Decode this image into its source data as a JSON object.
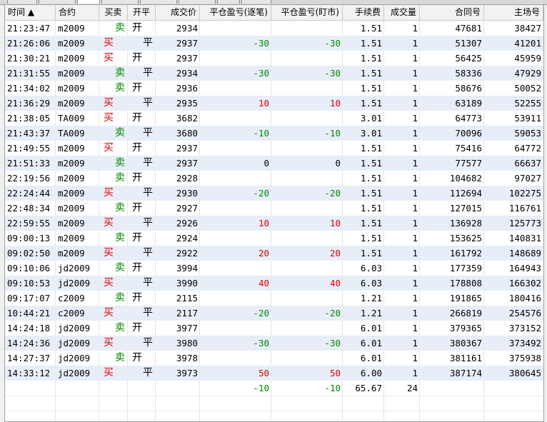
{
  "columns": {
    "time": "时间 ▲",
    "contract": "合约",
    "side": "买卖",
    "open_close": "开平",
    "price": "成交价",
    "pnl_trade": "平仓盈亏(逐笔)",
    "pnl_mark": "平仓盈亏(盯市)",
    "fee": "手续费",
    "volume": "成交量",
    "contract_no": "合同号",
    "main_no": "主场号"
  },
  "rows": [
    {
      "time": "21:23:47",
      "contract": "m2009",
      "side": "卖",
      "oc": "开",
      "price": "2934",
      "pnl_trade": "",
      "pnl_mark": "",
      "fee": "1.51",
      "vol": "1",
      "cno": "47681",
      "mno": "38427"
    },
    {
      "time": "21:26:06",
      "contract": "m2009",
      "side": "买",
      "oc": "平",
      "price": "2937",
      "pnl_trade": "-30",
      "pnl_mark": "-30",
      "fee": "1.51",
      "vol": "1",
      "cno": "51307",
      "mno": "41201"
    },
    {
      "time": "21:30:21",
      "contract": "m2009",
      "side": "买",
      "oc": "开",
      "price": "2937",
      "pnl_trade": "",
      "pnl_mark": "",
      "fee": "1.51",
      "vol": "1",
      "cno": "56425",
      "mno": "45959"
    },
    {
      "time": "21:31:55",
      "contract": "m2009",
      "side": "卖",
      "oc": "平",
      "price": "2934",
      "pnl_trade": "-30",
      "pnl_mark": "-30",
      "fee": "1.51",
      "vol": "1",
      "cno": "58336",
      "mno": "47929"
    },
    {
      "time": "21:34:02",
      "contract": "m2009",
      "side": "卖",
      "oc": "开",
      "price": "2936",
      "pnl_trade": "",
      "pnl_mark": "",
      "fee": "1.51",
      "vol": "1",
      "cno": "58676",
      "mno": "50052"
    },
    {
      "time": "21:36:29",
      "contract": "m2009",
      "side": "买",
      "oc": "平",
      "price": "2935",
      "pnl_trade": "10",
      "pnl_mark": "10",
      "fee": "1.51",
      "vol": "1",
      "cno": "63189",
      "mno": "52255"
    },
    {
      "time": "21:38:05",
      "contract": "TA009",
      "side": "买",
      "oc": "开",
      "price": "3682",
      "pnl_trade": "",
      "pnl_mark": "",
      "fee": "3.01",
      "vol": "1",
      "cno": "64773",
      "mno": "53911"
    },
    {
      "time": "21:43:37",
      "contract": "TA009",
      "side": "卖",
      "oc": "平",
      "price": "3680",
      "pnl_trade": "-10",
      "pnl_mark": "-10",
      "fee": "3.01",
      "vol": "1",
      "cno": "70096",
      "mno": "59053"
    },
    {
      "time": "21:49:55",
      "contract": "m2009",
      "side": "买",
      "oc": "开",
      "price": "2937",
      "pnl_trade": "",
      "pnl_mark": "",
      "fee": "1.51",
      "vol": "1",
      "cno": "75416",
      "mno": "64772"
    },
    {
      "time": "21:51:33",
      "contract": "m2009",
      "side": "卖",
      "oc": "平",
      "price": "2937",
      "pnl_trade": "0",
      "pnl_mark": "0",
      "fee": "1.51",
      "vol": "1",
      "cno": "77577",
      "mno": "66637"
    },
    {
      "time": "22:19:56",
      "contract": "m2009",
      "side": "卖",
      "oc": "开",
      "price": "2928",
      "pnl_trade": "",
      "pnl_mark": "",
      "fee": "1.51",
      "vol": "1",
      "cno": "104682",
      "mno": "97027"
    },
    {
      "time": "22:24:44",
      "contract": "m2009",
      "side": "买",
      "oc": "平",
      "price": "2930",
      "pnl_trade": "-20",
      "pnl_mark": "-20",
      "fee": "1.51",
      "vol": "1",
      "cno": "112694",
      "mno": "102275"
    },
    {
      "time": "22:48:34",
      "contract": "m2009",
      "side": "卖",
      "oc": "开",
      "price": "2927",
      "pnl_trade": "",
      "pnl_mark": "",
      "fee": "1.51",
      "vol": "1",
      "cno": "127015",
      "mno": "116761"
    },
    {
      "time": "22:59:55",
      "contract": "m2009",
      "side": "买",
      "oc": "平",
      "price": "2926",
      "pnl_trade": "10",
      "pnl_mark": "10",
      "fee": "1.51",
      "vol": "1",
      "cno": "136928",
      "mno": "125773"
    },
    {
      "time": "09:00:13",
      "contract": "m2009",
      "side": "卖",
      "oc": "开",
      "price": "2924",
      "pnl_trade": "",
      "pnl_mark": "",
      "fee": "1.51",
      "vol": "1",
      "cno": "153625",
      "mno": "140831"
    },
    {
      "time": "09:02:50",
      "contract": "m2009",
      "side": "买",
      "oc": "平",
      "price": "2922",
      "pnl_trade": "20",
      "pnl_mark": "20",
      "fee": "1.51",
      "vol": "1",
      "cno": "161792",
      "mno": "148689"
    },
    {
      "time": "09:10:06",
      "contract": "jd2009",
      "side": "卖",
      "oc": "开",
      "price": "3994",
      "pnl_trade": "",
      "pnl_mark": "",
      "fee": "6.03",
      "vol": "1",
      "cno": "177359",
      "mno": "164943"
    },
    {
      "time": "09:10:53",
      "contract": "jd2009",
      "side": "买",
      "oc": "平",
      "price": "3990",
      "pnl_trade": "40",
      "pnl_mark": "40",
      "fee": "6.03",
      "vol": "1",
      "cno": "178808",
      "mno": "166302"
    },
    {
      "time": "09:17:07",
      "contract": "c2009",
      "side": "卖",
      "oc": "开",
      "price": "2115",
      "pnl_trade": "",
      "pnl_mark": "",
      "fee": "1.21",
      "vol": "1",
      "cno": "191865",
      "mno": "180416"
    },
    {
      "time": "10:44:21",
      "contract": "c2009",
      "side": "买",
      "oc": "平",
      "price": "2117",
      "pnl_trade": "-20",
      "pnl_mark": "-20",
      "fee": "1.21",
      "vol": "1",
      "cno": "266819",
      "mno": "254576"
    },
    {
      "time": "14:24:18",
      "contract": "jd2009",
      "side": "卖",
      "oc": "开",
      "price": "3977",
      "pnl_trade": "",
      "pnl_mark": "",
      "fee": "6.01",
      "vol": "1",
      "cno": "379365",
      "mno": "373152"
    },
    {
      "time": "14:24:36",
      "contract": "jd2009",
      "side": "买",
      "oc": "平",
      "price": "3980",
      "pnl_trade": "-30",
      "pnl_mark": "-30",
      "fee": "6.01",
      "vol": "1",
      "cno": "380367",
      "mno": "373492"
    },
    {
      "time": "14:27:37",
      "contract": "jd2009",
      "side": "卖",
      "oc": "开",
      "price": "3978",
      "pnl_trade": "",
      "pnl_mark": "",
      "fee": "6.01",
      "vol": "1",
      "cno": "381161",
      "mno": "375938"
    },
    {
      "time": "14:33:12",
      "contract": "jd2009",
      "side": "买",
      "oc": "平",
      "price": "3973",
      "pnl_trade": "50",
      "pnl_mark": "50",
      "fee": "6.00",
      "vol": "1",
      "cno": "387174",
      "mno": "380645"
    }
  ],
  "summary": {
    "pnl_trade": "-10",
    "pnl_mark": "-10",
    "fee": "65.67",
    "volume": "24"
  },
  "colors": {
    "buy": "#e00000",
    "sell": "#008800",
    "alt_row": "#e8eef8"
  }
}
